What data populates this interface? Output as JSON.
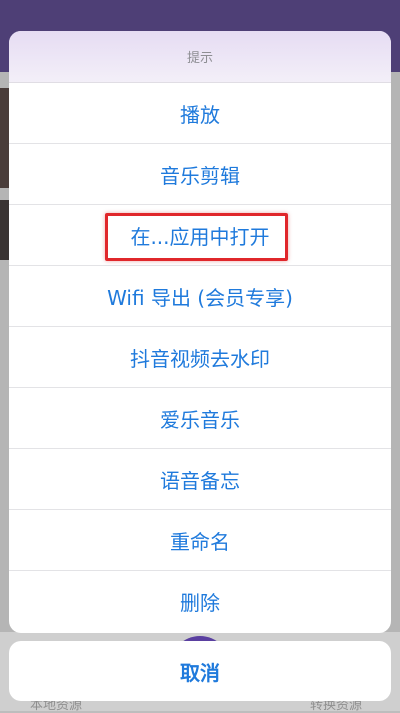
{
  "sheet": {
    "title": "提示",
    "items": [
      {
        "label": "播放"
      },
      {
        "label": "音乐剪辑"
      },
      {
        "label": "在...应用中打开"
      },
      {
        "label": "Wifi 导出 (会员专享)"
      },
      {
        "label": "抖音视频去水印"
      },
      {
        "label": "爱乐音乐"
      },
      {
        "label": "语音备忘"
      },
      {
        "label": "重命名"
      },
      {
        "label": "删除"
      }
    ],
    "cancel_label": "取消"
  },
  "background": {
    "tab_left": "本地资源",
    "tab_right": "转换资源"
  },
  "colors": {
    "accent": "#1f7adc",
    "highlight": "#e0272b",
    "header_bg": "#4e3f76"
  }
}
